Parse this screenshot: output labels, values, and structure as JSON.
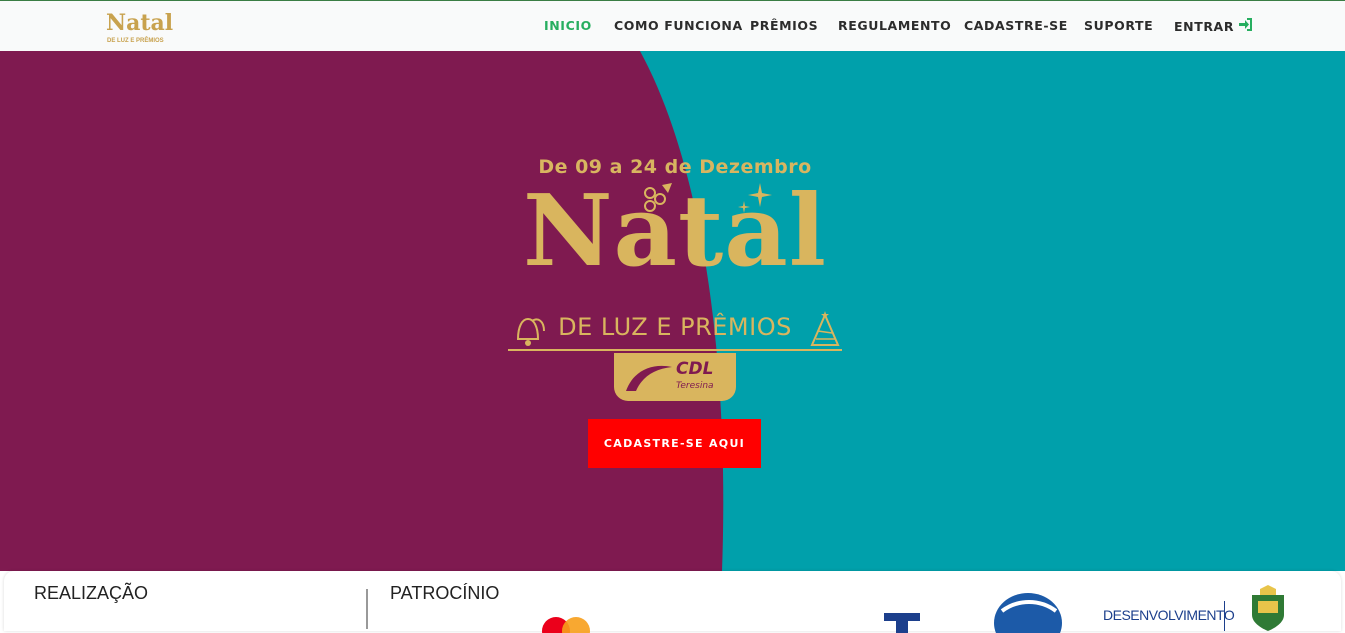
{
  "brand": {
    "logo_title": "Natal",
    "logo_subtitle": "DE LUZ E PRÊMIOS"
  },
  "nav": {
    "items": [
      {
        "label": "INICIO",
        "active": true
      },
      {
        "label": "COMO FUNCIONA",
        "active": false
      },
      {
        "label": "PRÊMIOS",
        "active": false
      },
      {
        "label": "REGULAMENTO",
        "active": false
      },
      {
        "label": "CADASTRE-SE",
        "active": false
      },
      {
        "label": "SUPORTE",
        "active": false
      },
      {
        "label": "ENTRAR",
        "active": false,
        "icon": "login-icon"
      }
    ]
  },
  "hero": {
    "date_text": "De 09 a 24 de Dezembro",
    "title": "Natal",
    "subtitle": "DE LUZ E PRÊMIOS",
    "cdl_name": "CDL",
    "cdl_city": "Teresina",
    "cta_label": "CADASTRE-SE AQUI"
  },
  "sponsors": {
    "realizacao_label": "REALIZAÇÃO",
    "patrocinio_label": "PATROCÍNIO",
    "partial_text": "DESENVOLVIMENTO"
  },
  "colors": {
    "hero_left": "#7f1a50",
    "hero_right": "#00a0ab",
    "gold": "#d9b55e",
    "active_nav": "#27ae60",
    "cta": "#ff0000"
  }
}
